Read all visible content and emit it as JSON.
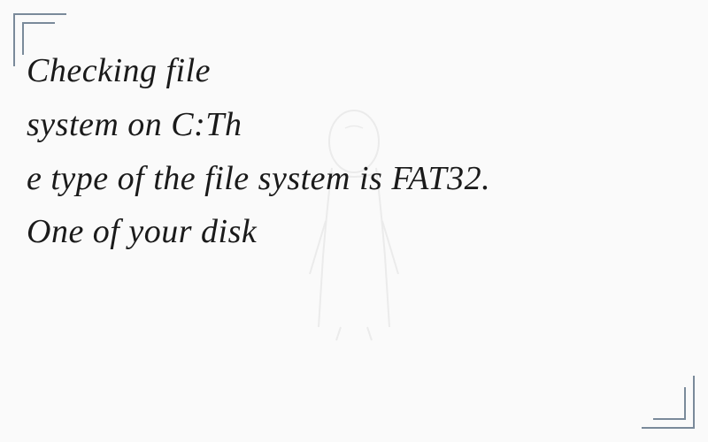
{
  "lines": {
    "l1": "Checking file",
    "l2": "system on C:Th",
    "l3": "e type of the file system is FAT32.",
    "l4": "One of your disk"
  }
}
